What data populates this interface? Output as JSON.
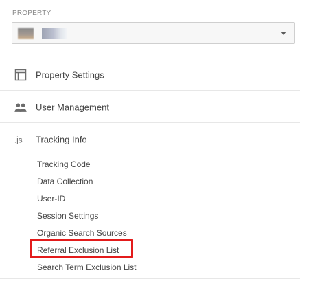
{
  "property": {
    "label": "PROPERTY",
    "selected_value": ""
  },
  "nav": {
    "items": [
      {
        "label": "Property Settings",
        "icon": "property-settings-icon"
      },
      {
        "label": "User Management",
        "icon": "users-icon"
      },
      {
        "label": "Tracking Info",
        "icon": "js-icon"
      }
    ]
  },
  "tracking_info": {
    "items": [
      {
        "label": "Tracking Code"
      },
      {
        "label": "Data Collection"
      },
      {
        "label": "User-ID"
      },
      {
        "label": "Session Settings"
      },
      {
        "label": "Organic Search Sources"
      },
      {
        "label": "Referral Exclusion List"
      },
      {
        "label": "Search Term Exclusion List"
      }
    ]
  },
  "colors": {
    "highlight": "#e31b1b",
    "text_primary": "#444444",
    "icon_gray": "#6c6c6c",
    "border_gray": "#cfcfcf"
  }
}
